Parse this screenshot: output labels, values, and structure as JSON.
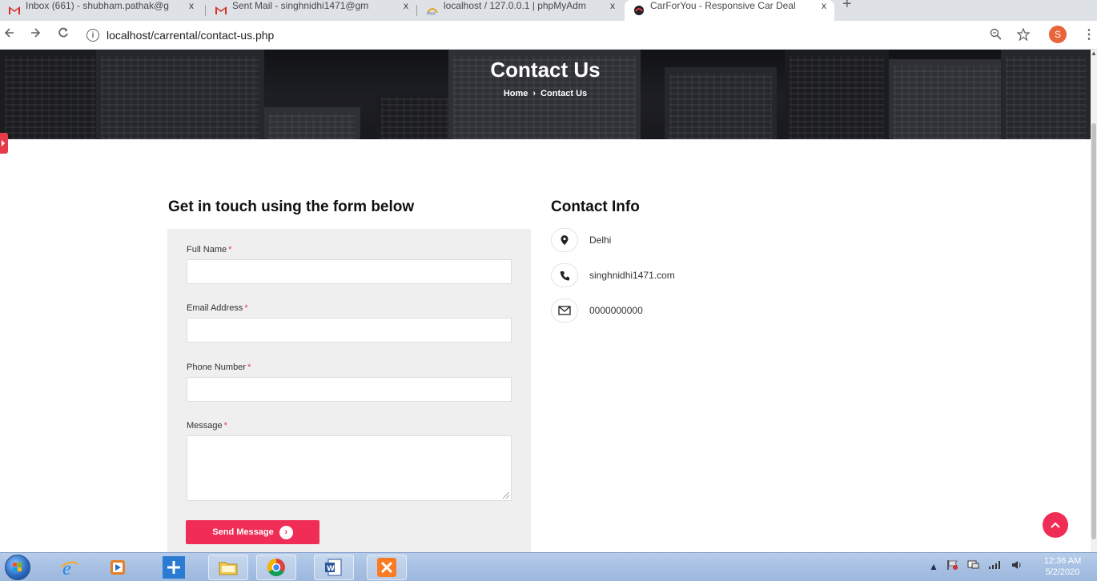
{
  "browser": {
    "tabs": [
      {
        "title": "Inbox (661) - shubham.pathak@g",
        "icon": "gmail-icon",
        "active": false
      },
      {
        "title": "Sent Mail - singhnidhi1471@gm",
        "icon": "gmail-icon",
        "active": false
      },
      {
        "title": "localhost / 127.0.0.1 | phpMyAdm",
        "icon": "phpmyadmin-icon",
        "active": false
      },
      {
        "title": "CarForYou - Responsive Car Deal",
        "icon": "site-icon",
        "active": true
      }
    ],
    "tab_close_glyph": "x",
    "new_tab_glyph": "+",
    "url": "localhost/carrental/contact-us.php",
    "profile_initial": "S"
  },
  "hero": {
    "title": "Contact Us",
    "breadcrumb": {
      "home": "Home",
      "separator": "›",
      "current": "Contact Us"
    }
  },
  "form": {
    "heading": "Get in touch using the form below",
    "required_marker": "*",
    "fields": [
      {
        "label": "Full Name",
        "value": ""
      },
      {
        "label": "Email Address",
        "value": ""
      },
      {
        "label": "Phone Number",
        "value": ""
      },
      {
        "label": "Message",
        "value": ""
      }
    ],
    "submit_label": "Send Message"
  },
  "contact_info": {
    "heading": "Contact Info",
    "items": [
      {
        "icon": "map-marker-icon",
        "text": "Delhi"
      },
      {
        "icon": "phone-icon",
        "text": "singhnidhi1471.com"
      },
      {
        "icon": "envelope-icon",
        "text": "0000000000"
      }
    ]
  },
  "taskbar": {
    "clock_time": "12:36 AM",
    "clock_date": "5/2/2020"
  },
  "colors": {
    "accent": "#f02d56",
    "form_background": "#efefef",
    "taskbar": "#a7c0e3"
  }
}
